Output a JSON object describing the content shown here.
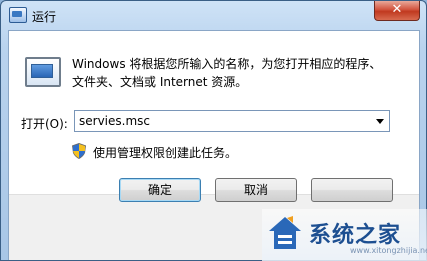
{
  "window": {
    "title": "运行",
    "close_glyph": "✕"
  },
  "dialog": {
    "description": "Windows 将根据您所输入的名称，为您打开相应的程序、文件夹、文档或 Internet 资源。",
    "open_label": "打开(O):",
    "open_value": "servies.msc",
    "admin_note": "使用管理权限创建此任务。",
    "ok_label": "确定",
    "cancel_label": "取消",
    "browse_label": ""
  },
  "icons": {
    "title": "run-app-icon",
    "run": "run-dialog-icon",
    "shield": "uac-shield-icon",
    "dropdown": "chevron-down-icon"
  },
  "watermark": {
    "text": "系统之家",
    "url": "www.xitongzhijia.net"
  },
  "colors": {
    "close_button": "#c0391f",
    "title_gradient": "#a8c6e6",
    "watermark_text": "#1d4f91"
  }
}
